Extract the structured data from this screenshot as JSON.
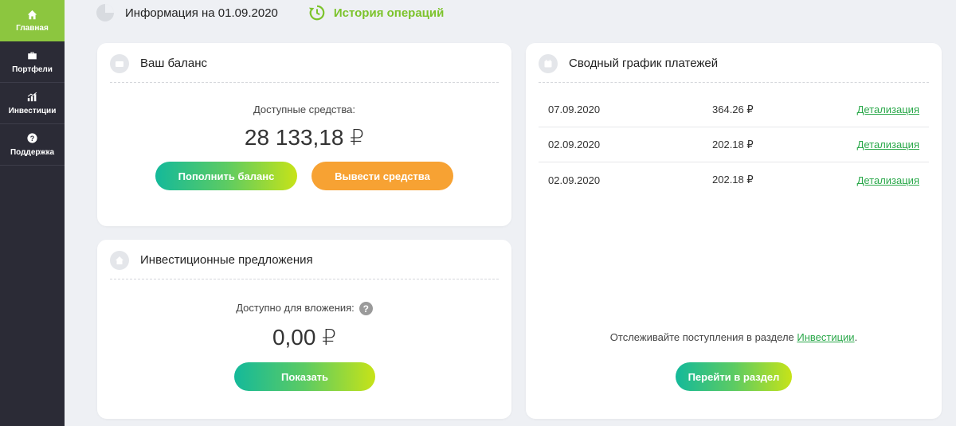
{
  "sidebar": {
    "items": [
      {
        "label": "Главная",
        "icon": "home-icon",
        "active": true
      },
      {
        "label": "Портфели",
        "icon": "briefcase-icon",
        "active": false
      },
      {
        "label": "Инвестиции",
        "icon": "chart-icon",
        "active": false
      },
      {
        "label": "Поддержка",
        "icon": "help-icon",
        "active": false
      }
    ]
  },
  "header": {
    "info": "Информация на 01.09.2020",
    "history": "История операций"
  },
  "balance": {
    "title": "Ваш баланс",
    "available_label": "Доступные средства:",
    "amount": "28 133,18 ₽",
    "topup_label": "Пополнить баланс",
    "withdraw_label": "Вывести средства"
  },
  "offers": {
    "title": "Инвестиционные предложения",
    "available_label": "Доступно для вложения:",
    "help": "?",
    "amount": "0,00 ₽",
    "show_label": "Показать"
  },
  "payments": {
    "title": "Сводный график платежей",
    "rows": [
      {
        "date": "07.09.2020",
        "sum": "364.26 ₽",
        "link": "Детализация"
      },
      {
        "date": "02.09.2020",
        "sum": "202.18 ₽",
        "link": "Детализация"
      },
      {
        "date": "02.09.2020",
        "sum": "202.18 ₽",
        "link": "Детализация"
      }
    ],
    "track_prefix": "Отслеживайте поступления в разделе ",
    "track_link": "Инвестиции",
    "track_suffix": ".",
    "goto_label": "Перейти в раздел"
  },
  "colors": {
    "accent_green": "#8cc63f",
    "sidebar_bg": "#2b2b36",
    "orange": "#f7a233",
    "link_green": "#2aa84a"
  }
}
